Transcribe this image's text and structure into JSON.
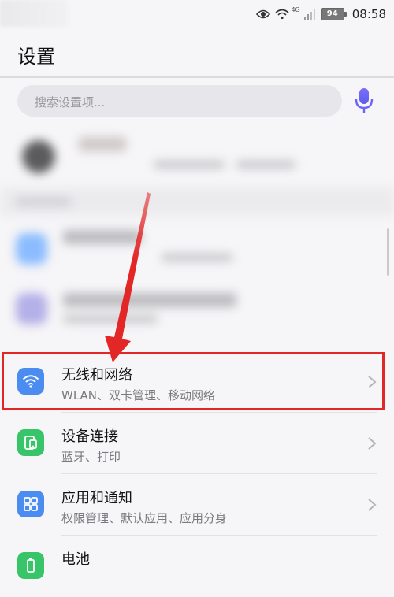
{
  "status_bar": {
    "time": "08:58",
    "battery_level": "94",
    "network_type": "4G"
  },
  "header": {
    "title": "设置"
  },
  "search": {
    "placeholder": "搜索设置项..."
  },
  "settings_items": [
    {
      "title": "无线和网络",
      "subtitle": "WLAN、双卡管理、移动网络",
      "icon": "wifi-icon",
      "icon_color": "#4a8cf0"
    },
    {
      "title": "设备连接",
      "subtitle": "蓝牙、打印",
      "icon": "device-link-icon",
      "icon_color": "#38c56a"
    },
    {
      "title": "应用和通知",
      "subtitle": "权限管理、默认应用、应用分身",
      "icon": "apps-grid-icon",
      "icon_color": "#4a8cf0"
    },
    {
      "title": "电池",
      "subtitle": "",
      "icon": "battery-icon",
      "icon_color": "#38c56a"
    }
  ],
  "colors": {
    "highlight": "#e32626",
    "accent": "#4a8cf0",
    "mic": "#6c63ff"
  }
}
